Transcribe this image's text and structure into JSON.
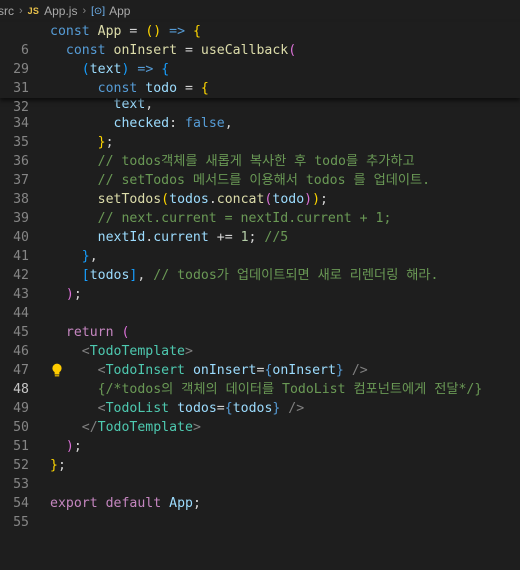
{
  "breadcrumb": {
    "folder": "src",
    "file_badge": "JS",
    "file": "App.js",
    "symbol_icon": "[⊙]",
    "symbol": "App"
  },
  "editor": {
    "active_line": "48",
    "sticky_lines": [
      {
        "n": "6"
      },
      {
        "n": "29"
      },
      {
        "n": "31"
      },
      {
        "n": "32"
      }
    ],
    "lines": [
      {
        "n": "34"
      },
      {
        "n": "35"
      },
      {
        "n": "36"
      },
      {
        "n": "37"
      },
      {
        "n": "38"
      },
      {
        "n": "39"
      },
      {
        "n": "40"
      },
      {
        "n": "41"
      },
      {
        "n": "42"
      },
      {
        "n": "43"
      },
      {
        "n": "44"
      },
      {
        "n": "45"
      },
      {
        "n": "46"
      },
      {
        "n": "47"
      },
      {
        "n": "48"
      },
      {
        "n": "49"
      },
      {
        "n": "50"
      },
      {
        "n": "51"
      },
      {
        "n": "52"
      },
      {
        "n": "53"
      },
      {
        "n": "54"
      },
      {
        "n": "55"
      }
    ],
    "tokens": {
      "const": "const",
      "app": "App",
      "eq": " = ",
      "paren_open": "(",
      "paren_close": ")",
      "arrow": " => ",
      "brace_open": "{",
      "brace_close": "}",
      "on_insert": "onInsert",
      "use_callback": "useCallback",
      "text": "text",
      "todo": "todo",
      "comma": ",",
      "checked": "checked",
      "colon": ": ",
      "false": "false",
      "close_brace_semi": "};",
      "comment_37": "// todos객체를 새롭게 복사한 후 todo를 추가하고",
      "comment_38": "// setTodos 메서드를 이용해서 todos 를 업데이트.",
      "set_todos": "setTodos",
      "todos": "todos",
      "dot": ".",
      "concat": "concat",
      "semi": ";",
      "comment_40": "// next.current = nextId.current + 1;",
      "next_id": "nextId",
      "current": "current",
      "plus_eq": " += ",
      "one": "1",
      "comment_41": " //5",
      "bracket_open": "[",
      "bracket_close": "]",
      "comment_43": " // todos가 업데이트되면 새로 리렌더링 해라.",
      "close_paren_semi": ");",
      "return": "return",
      "lt": "<",
      "gt": ">",
      "lt_slash": "</",
      "slash_gt": " />",
      "todo_template": "TodoTemplate",
      "todo_insert": "TodoInsert",
      "todo_list": "TodoList",
      "attr_eq": "=",
      "jsx_comment": "{/*todos의 객체의 데이터를 TodoList 컴포넌트에게 전달*/}",
      "export": "export",
      "default": "default"
    }
  }
}
